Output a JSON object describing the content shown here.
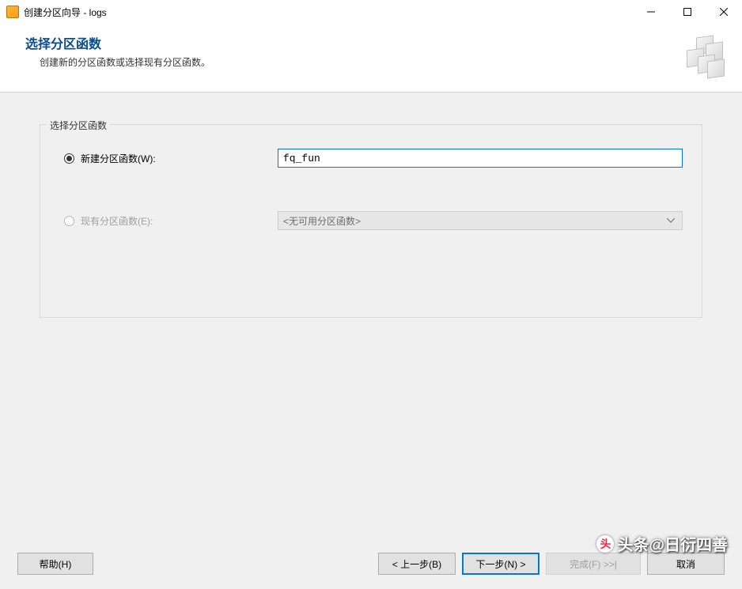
{
  "titlebar": {
    "title": "创建分区向导 - logs"
  },
  "header": {
    "title": "选择分区函数",
    "subtitle": "创建新的分区函数或选择现有分区函数。"
  },
  "fieldset": {
    "legend": "选择分区函数",
    "new_function_label": "新建分区函数(W):",
    "new_function_value": "fq_fun",
    "existing_function_label": "现有分区函数(E):",
    "existing_function_placeholder": "<无可用分区函数>"
  },
  "footer": {
    "help": "帮助(H)",
    "back": "< 上一步(B)",
    "next": "下一步(N) >",
    "finish": "完成(F) >>|",
    "cancel": "取消"
  },
  "watermark": {
    "text": "头条@日衍四善"
  }
}
